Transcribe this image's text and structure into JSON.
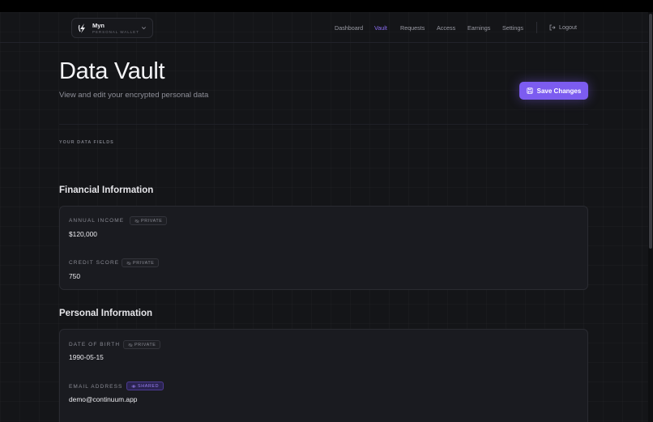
{
  "brand": {
    "name": "Myn",
    "subtitle": "PERSONAL WALLET"
  },
  "nav": {
    "items": [
      "Dashboard",
      "Vault",
      "Requests",
      "Access",
      "Earnings",
      "Settings"
    ],
    "active": "Vault",
    "logout": "Logout"
  },
  "page": {
    "title": "Data Vault",
    "subtitle": "View and edit your encrypted personal data",
    "save_label": "Save Changes",
    "fields_heading": "YOUR DATA FIELDS"
  },
  "sections": [
    {
      "title": "Financial Information",
      "fields": [
        {
          "label": "ANNUAL INCOME",
          "badge": "PRIVATE",
          "value": "$120,000"
        },
        {
          "label": "CREDIT SCORE",
          "badge": "PRIVATE",
          "value": "750"
        }
      ]
    },
    {
      "title": "Personal Information",
      "fields": [
        {
          "label": "DATE OF BIRTH",
          "badge": "PRIVATE",
          "value": "1990-05-15"
        },
        {
          "label": "EMAIL ADDRESS",
          "badge": "SHARED",
          "value": "demo@continuum.app"
        }
      ]
    }
  ],
  "colors": {
    "accent": "#7c5cf0",
    "background": "#141518",
    "card": "#1a1b20"
  },
  "icons": {
    "logo": "myn-logo-icon",
    "chevron": "chevron-down-icon",
    "logout": "logout-icon",
    "save": "save-icon",
    "private": "eye-off-icon",
    "shared": "eye-icon"
  }
}
